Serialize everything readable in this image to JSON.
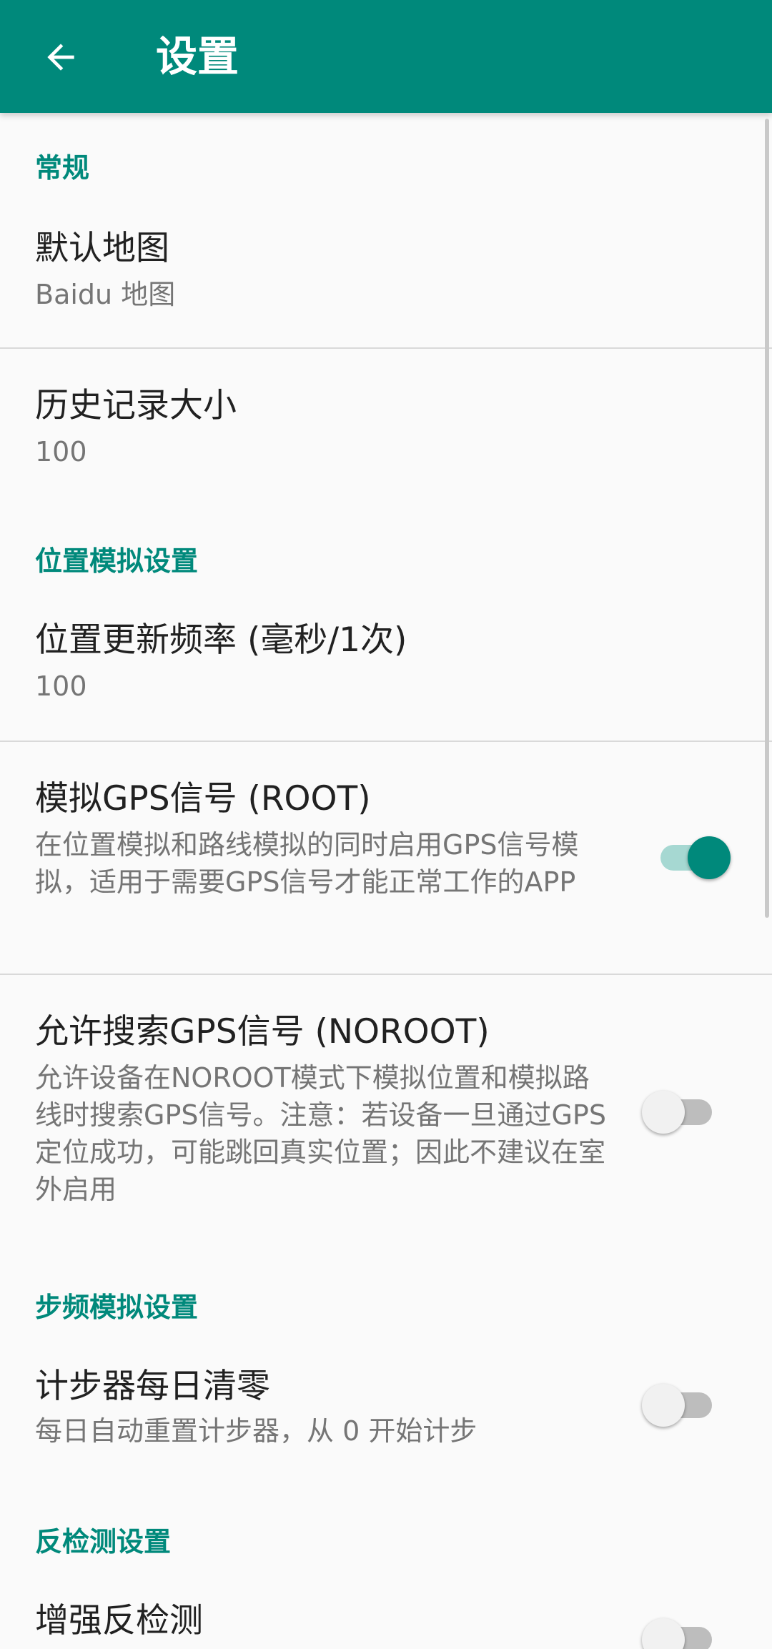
{
  "appbar": {
    "title": "设置",
    "back_icon": "arrow-back-icon",
    "color": "#00897b"
  },
  "sections": {
    "general": {
      "title": "常规"
    },
    "location": {
      "title": "位置模拟设置"
    },
    "step": {
      "title": "步频模拟设置"
    },
    "anti": {
      "title": "反检测设置"
    }
  },
  "prefs": {
    "default_map": {
      "title": "默认地图",
      "summary": "Baidu 地图"
    },
    "history_size": {
      "title": "历史记录大小",
      "summary": "100"
    },
    "update_rate": {
      "title": "位置更新频率 (毫秒/1次)",
      "summary": "100"
    },
    "mock_gps": {
      "title": "模拟GPS信号 (ROOT)",
      "summary": "在位置模拟和路线模拟的同时启用GPS信号模拟，适用于需要GPS信号才能正常工作的APP",
      "enabled": true
    },
    "allow_gps_search": {
      "title": "允许搜索GPS信号 (NOROOT)",
      "summary": "允许设备在NOROOT模式下模拟位置和模拟路线时搜索GPS信号。注意：若设备一旦通过GPS定位成功，可能跳回真实位置；因此不建议在室外启用",
      "enabled": false
    },
    "step_reset": {
      "title": "计步器每日清零",
      "summary": "每日自动重置计步器，从 0 开始计步",
      "enabled": false
    },
    "enhanced_anti": {
      "title": "增强反检测",
      "enabled": false
    }
  },
  "colors": {
    "accent": "#00897b",
    "accent_track": "#a6d8d2",
    "text_primary": "#212121",
    "text_secondary": "#757575"
  }
}
